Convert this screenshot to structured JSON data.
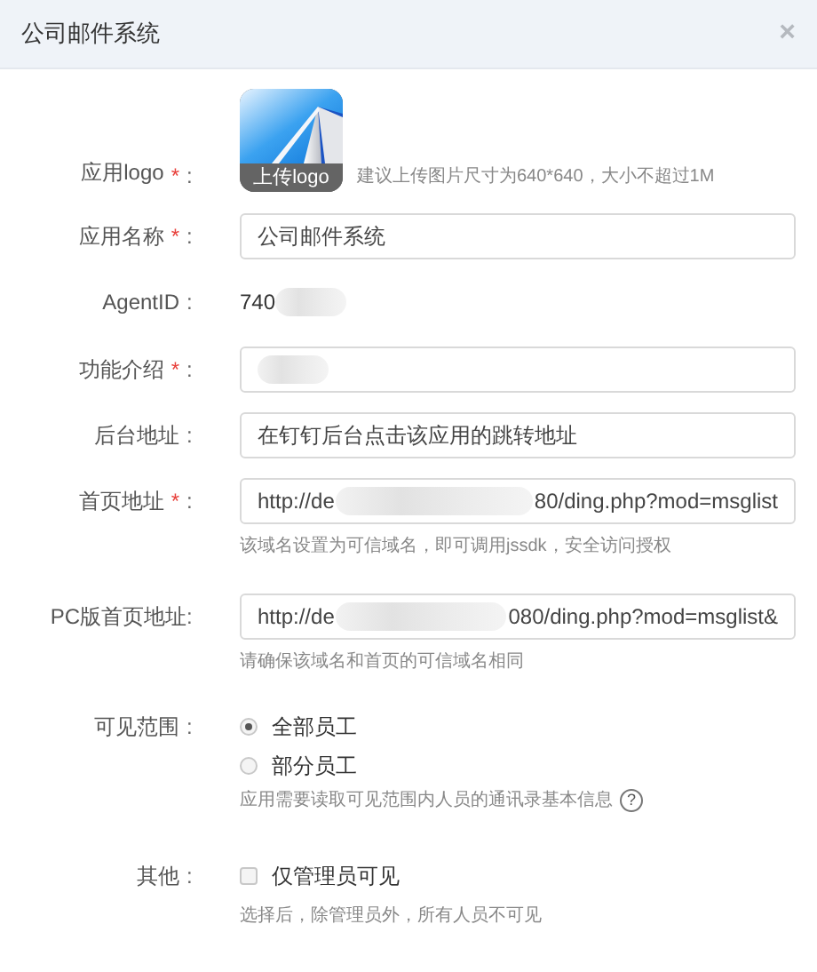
{
  "dialog": {
    "title": "公司邮件系统",
    "close": "×"
  },
  "form": [
    {
      "kind": "logo",
      "label": "应用logo",
      "required_mark": "*",
      "colon": ":",
      "button": "上传logo",
      "hint": "建议上传图片尺寸为640*640，大小不超过1M"
    },
    {
      "kind": "input",
      "label": "应用名称",
      "required_mark": "*",
      "colon": ":",
      "value": "公司邮件系统"
    },
    {
      "kind": "text",
      "label": "AgentID",
      "colon": ":",
      "value": "740",
      "redacted": true
    },
    {
      "kind": "input",
      "label": "功能介绍",
      "required_mark": "*",
      "colon": ":",
      "redacted": true
    },
    {
      "kind": "input",
      "label": "后台地址",
      "colon": ":",
      "placeholder": "在钉钉后台点击该应用的跳转地址"
    },
    {
      "kind": "input",
      "label": "首页地址",
      "required_mark": "*",
      "colon": ":",
      "value": "http://de",
      "redacted": true,
      "value_end": "80/ding.php?mod=msglist",
      "hint": "该域名设置为可信域名，即可调用jssdk，安全访问授权"
    },
    {
      "kind": "input",
      "label": "PC版首页地址",
      "colon": ":",
      "tight": true,
      "value": "http://de",
      "redacted": true,
      "value_end": "080/ding.php?mod=msglist&",
      "hint": "请确保该域名和首页的可信域名相同"
    },
    {
      "kind": "radio",
      "label": "可见范围",
      "colon": ":",
      "options": [
        {
          "label": "全部员工",
          "selected": true
        },
        {
          "label": "部分员工",
          "selected": false
        }
      ],
      "hint": "应用需要读取可见范围内人员的通讯录基本信息",
      "help": "?"
    },
    {
      "kind": "checkbox",
      "label": "其他",
      "colon": ":",
      "option": "仅管理员可见",
      "checked": false,
      "hint": "选择后，除管理员外，所有人员不可见"
    }
  ]
}
